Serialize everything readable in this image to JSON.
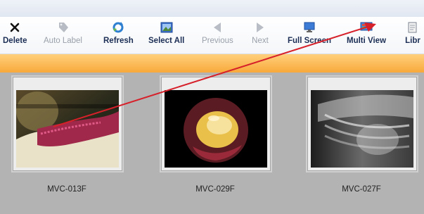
{
  "toolbar": {
    "buttons": [
      {
        "label": "Delete",
        "icon": "close-icon",
        "enabled": true
      },
      {
        "label": "Auto Label",
        "icon": "tag-icon",
        "enabled": false
      },
      {
        "label": "Refresh",
        "icon": "refresh-icon",
        "enabled": true
      },
      {
        "label": "Select All",
        "icon": "select-all-icon",
        "enabled": true
      },
      {
        "label": "Previous",
        "icon": "arrow-left-icon",
        "enabled": false
      },
      {
        "label": "Next",
        "icon": "arrow-right-icon",
        "enabled": false
      },
      {
        "label": "Full Screen",
        "icon": "monitor-icon",
        "enabled": true
      },
      {
        "label": "Multi View",
        "icon": "multi-view-icon",
        "enabled": true
      },
      {
        "label": "Libr",
        "icon": "library-icon",
        "enabled": true
      }
    ]
  },
  "gallery": {
    "items": [
      {
        "label": "MVC-013F",
        "image": "wound-photo"
      },
      {
        "label": "MVC-029F",
        "image": "endoscopic-photo"
      },
      {
        "label": "MVC-027F",
        "image": "x-ray-photo"
      }
    ]
  },
  "annotation": {
    "color": "#d6202a"
  },
  "colors": {
    "toolbar_text": "#1c2e55",
    "accent_bar": "#f8a93a",
    "panel": "#b3b3b3"
  }
}
